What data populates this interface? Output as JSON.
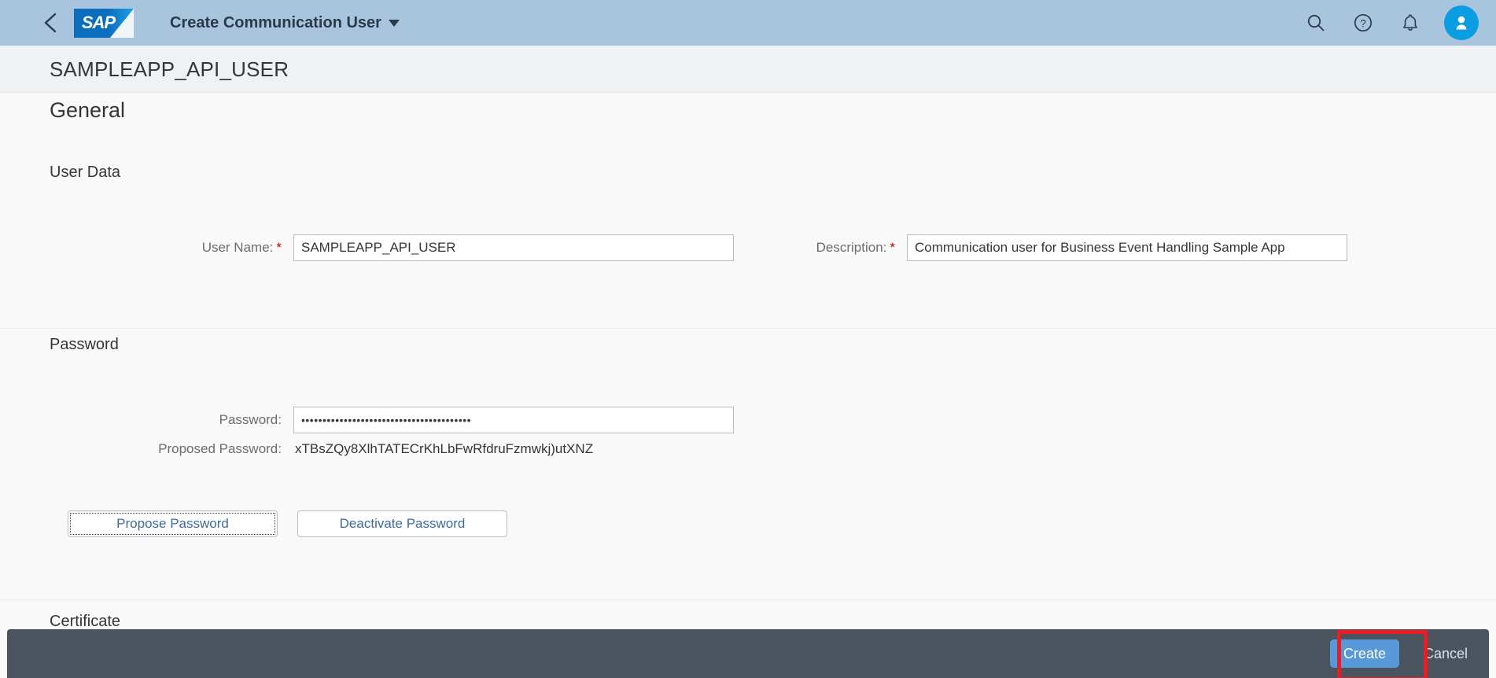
{
  "shellbar": {
    "back_icon": "chevron-left-icon",
    "logo_text": "SAP",
    "app_title": "Create Communication User",
    "icons": [
      "search-icon",
      "help-icon",
      "notifications-bell-icon",
      "user-avatar-icon"
    ]
  },
  "object_header": {
    "title": "SAMPLEAPP_API_USER"
  },
  "general": {
    "section_title": "General",
    "user_data": {
      "subsection_title": "User Data",
      "user_name": {
        "label": "User Name:",
        "required_marker": "*",
        "value": "SAMPLEAPP_API_USER"
      },
      "description": {
        "label": "Description:",
        "required_marker": "*",
        "value": "Communication user for Business Event Handling Sample App"
      }
    },
    "password": {
      "subsection_title": "Password",
      "password_field": {
        "label": "Password:",
        "value": "••••••••••••••••••••••••••••••••••••••••"
      },
      "proposed_password": {
        "label": "Proposed Password:",
        "value": "xTBsZQy8XlhTATECrKhLbFwRfdruFzmwkj)utXNZ"
      },
      "propose_button": "Propose Password",
      "deactivate_button": "Deactivate Password"
    },
    "certificate": {
      "subsection_title": "Certificate"
    }
  },
  "footer": {
    "create_button": "Create",
    "cancel_button": "Cancel"
  },
  "colors": {
    "shellbar_bg": "#a9c5dd",
    "footer_bg": "#49545f",
    "primary_button": "#5899d9",
    "highlight": "#ec1c24",
    "required_star": "#bb0000",
    "link_text": "#3f6a9b"
  }
}
